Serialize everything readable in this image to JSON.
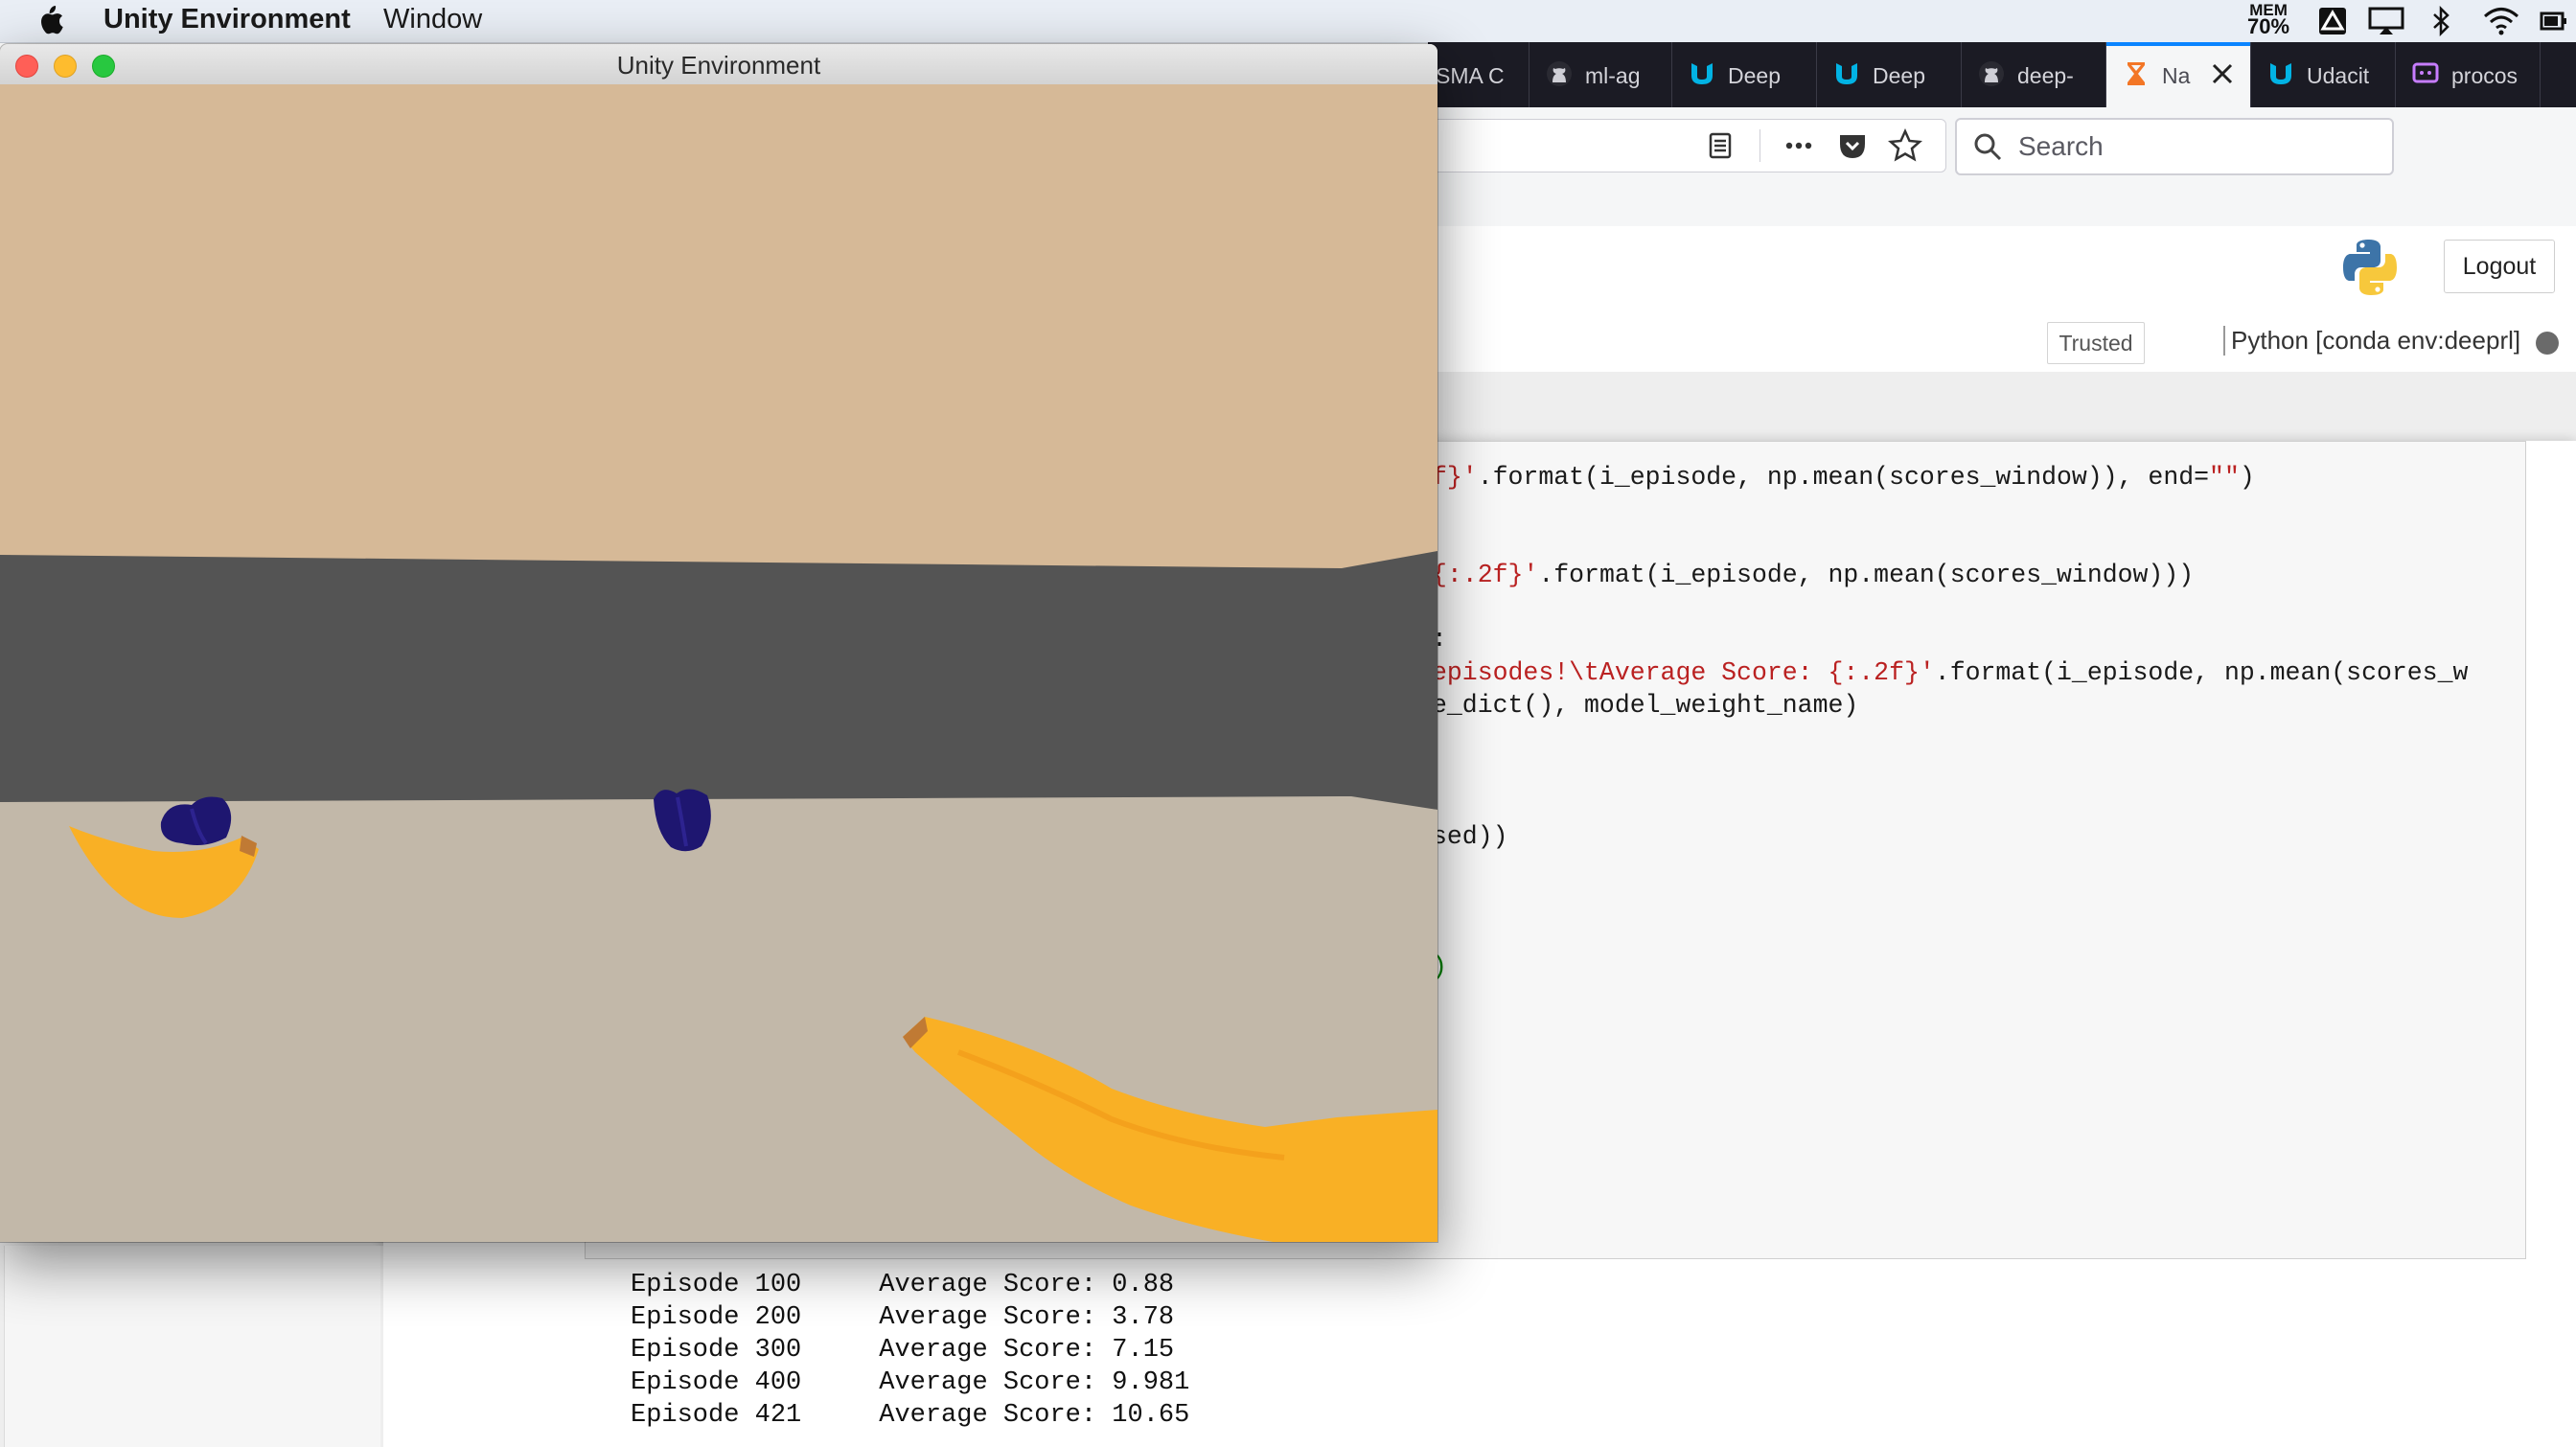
{
  "menubar": {
    "app_name": "Unity Environment",
    "menu_window": "Window",
    "mem_label": "MEM",
    "mem_value": "70%"
  },
  "browser": {
    "tabs": [
      {
        "label": "SMA C",
        "icon": "page-icon"
      },
      {
        "label": "ml-ag",
        "icon": "github-icon"
      },
      {
        "label": "Deep",
        "icon": "udacity-icon"
      },
      {
        "label": "Deep",
        "icon": "udacity-icon"
      },
      {
        "label": "deep-",
        "icon": "github-icon"
      },
      {
        "label": "Na",
        "icon": "hourglass-icon",
        "active": true
      },
      {
        "label": "Udacit",
        "icon": "udacity-icon"
      },
      {
        "label": "procos",
        "icon": "chat-icon"
      }
    ],
    "search_placeholder": "Search"
  },
  "jupyter": {
    "logout_label": "Logout",
    "trusted_label": "Trusted",
    "kernel_label": "Python [conda env:deeprl]"
  },
  "code": {
    "line1_str": "f}'",
    "line1_rest": ".format(i_episode, np.mean(scores_window)), end=",
    "line1_end_str": "\"\"",
    "line1_close": ")",
    "line2_str": "{:.2f}'",
    "line2_rest": ".format(i_episode, np.mean(scores_window)))",
    "line3": ":",
    "line4_str": "episodes!\\tAverage Score: {:.2f}'",
    "line4_rest": ".format(i_episode, np.mean(scores_w",
    "line5": "e_dict(), model_weight_name)",
    "line6": "sed))",
    "line7": ")"
  },
  "output": {
    "rows": [
      {
        "episode": "Episode 100",
        "score": "Average Score: 0.88"
      },
      {
        "episode": "Episode 200",
        "score": "Average Score: 3.78"
      },
      {
        "episode": "Episode 300",
        "score": "Average Score: 7.15"
      },
      {
        "episode": "Episode 400",
        "score": "Average Score: 9.981"
      },
      {
        "episode": "Episode 421",
        "score": "Average Score: 10.65"
      }
    ]
  },
  "unity_window": {
    "title": "Unity Environment",
    "colors": {
      "sky": "#d6b997",
      "wall": "#545454",
      "floor": "#c2b8a9",
      "banana_yellow": "#f9b025",
      "blue_banana": "#1e1670"
    }
  }
}
